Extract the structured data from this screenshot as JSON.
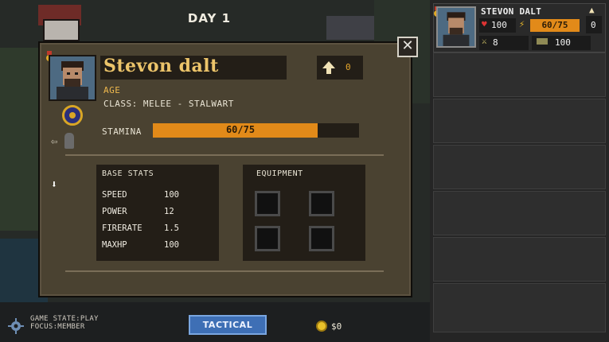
{
  "hud": {
    "day_label": "DAY 1",
    "status_line1": "GAME STATE:PLAY",
    "status_line2": "FOCUS:MEMBER",
    "tactical_label": "TACTICAL",
    "gold_value": "$0"
  },
  "character": {
    "name": "Stevon dalt",
    "level_value": "0",
    "age_label": "AGE",
    "class_label": "CLASS: MELEE - STALWART",
    "stamina_label": "STAMINA",
    "stamina_text": "60/75",
    "stamina_fraction": 0.8,
    "base_stats_title": "BASE STATS",
    "stats": [
      {
        "name": "SPEED",
        "value": "100"
      },
      {
        "name": "POWER",
        "value": "12"
      },
      {
        "name": "FIRERATE",
        "value": "1.5"
      },
      {
        "name": "MAXHP",
        "value": "100"
      }
    ],
    "equipment_title": "EQUIPMENT",
    "equipment_slots": [
      "",
      "",
      "",
      ""
    ]
  },
  "roster_card": {
    "name": "STEVON DALT",
    "health": "100",
    "stamina": "60/75",
    "level": "0",
    "power": "8",
    "speed": "100"
  },
  "icons": {
    "close": "close-icon",
    "level_up": "up-arrow-icon",
    "gear": "gear-icon",
    "coin": "coin-icon",
    "heart": "heart-icon",
    "lightning": "lightning-icon",
    "sword": "sword-icon",
    "boot": "boot-icon"
  },
  "colors": {
    "accent_orange": "#e28a19",
    "name_gold": "#ecc46a",
    "tactical_blue": "#3e6fb5"
  }
}
